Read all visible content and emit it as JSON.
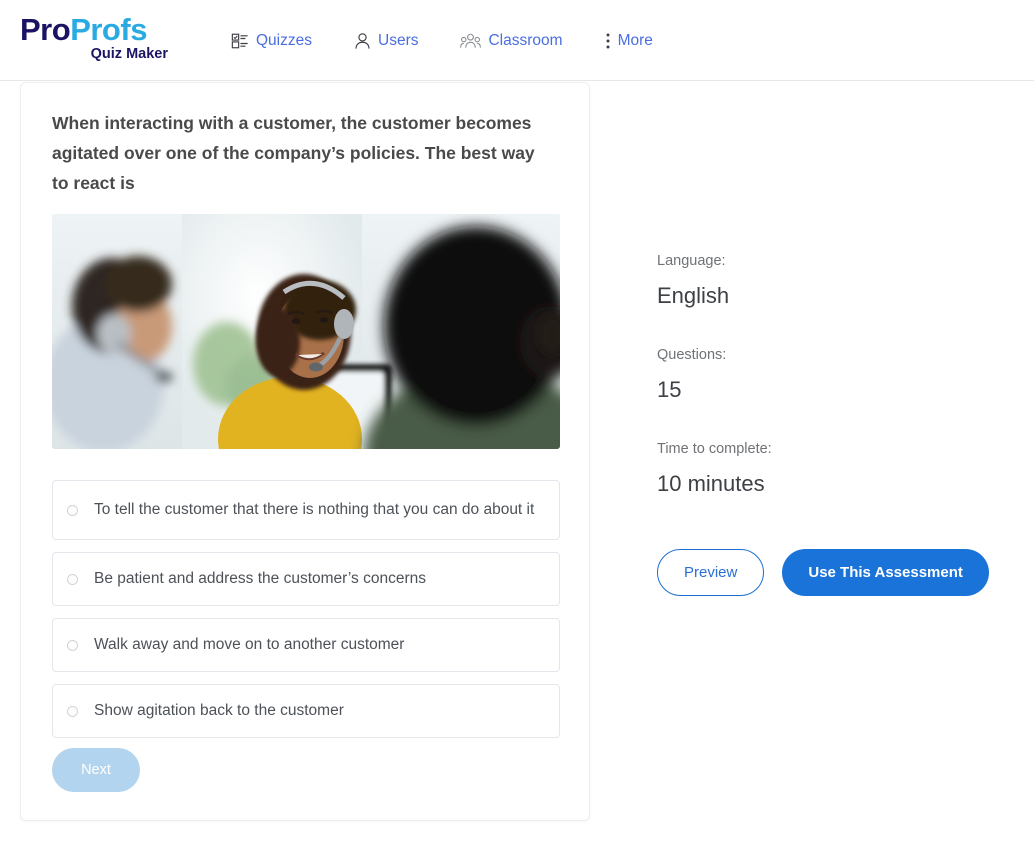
{
  "brand": {
    "name_part1": "Pro",
    "name_part2": "Profs",
    "tagline": "Quiz Maker",
    "color_primary": "#1b1464",
    "color_secondary": "#29abe2"
  },
  "nav": {
    "items": [
      {
        "label": "Quizzes",
        "icon": "checklist-icon"
      },
      {
        "label": "Users",
        "icon": "user-icon"
      },
      {
        "label": "Classroom",
        "icon": "group-icon"
      },
      {
        "label": "More",
        "icon": "vertical-dots-icon"
      }
    ],
    "link_color": "#4a6ee0"
  },
  "quiz": {
    "question": "When interacting with a customer, the customer becomes agitated over one of the company’s policies. The best way to react is",
    "image_alt": "Call center agents wearing headsets",
    "options": [
      {
        "label": "To tell the customer that there is nothing that you can do about it",
        "selected": false
      },
      {
        "label": "Be patient and address the customer’s concerns",
        "selected": false
      },
      {
        "label": "Walk away and move on to another customer",
        "selected": false
      },
      {
        "label": "Show agitation back to the customer",
        "selected": false
      }
    ],
    "next_label": "Next"
  },
  "details": {
    "language_label": "Language:",
    "language_value": "English",
    "questions_label": "Questions:",
    "questions_value": "15",
    "time_label": "Time to complete:",
    "time_value": "10 minutes"
  },
  "actions": {
    "preview_label": "Preview",
    "use_label": "Use This Assessment",
    "accent_color": "#1a73d9"
  }
}
